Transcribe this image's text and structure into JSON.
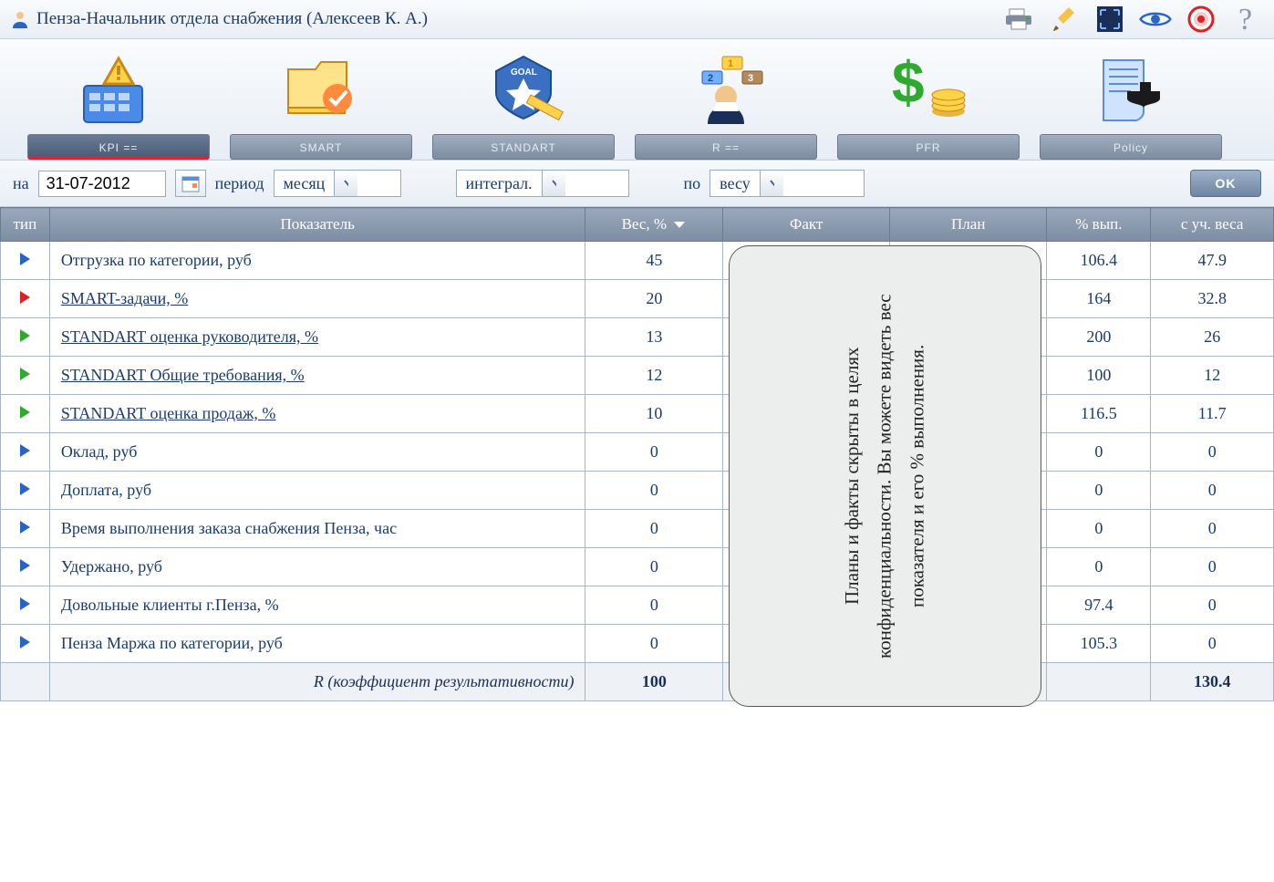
{
  "title": "Пенза-Начальник отдела снабжения  (Алексеев К. А.)",
  "nav": {
    "items": [
      {
        "label": "KPI  =="
      },
      {
        "label": "SMART"
      },
      {
        "label": "STANDART"
      },
      {
        "label": "R  =="
      },
      {
        "label": "PFR"
      },
      {
        "label": "Policy"
      }
    ]
  },
  "filter": {
    "on_label": "на",
    "date": "31-07-2012",
    "period_label": "период",
    "period_value": "месяц",
    "mode_value": "интеграл.",
    "by_label": "по",
    "by_value": "весу",
    "ok": "OK"
  },
  "columns": {
    "type": "тип",
    "indicator": "Показатель",
    "weight": "Вес, %",
    "fact": "Факт",
    "plan": "План",
    "vyp": "% вып.",
    "uweight": "с уч. веса"
  },
  "rows": [
    {
      "tri": "blue",
      "name": "Отгрузка по категории, руб",
      "link": false,
      "weight": "45",
      "vyp": "106.4",
      "uw": "47.9"
    },
    {
      "tri": "red",
      "name": "SMART-задачи, %",
      "link": true,
      "weight": "20",
      "vyp": "164",
      "uw": "32.8"
    },
    {
      "tri": "green",
      "name": "STANDART оценка руководителя, %",
      "link": true,
      "weight": "13",
      "vyp": "200",
      "uw": "26"
    },
    {
      "tri": "green",
      "name": "STANDART Общие требования, %",
      "link": true,
      "weight": "12",
      "vyp": "100",
      "uw": "12"
    },
    {
      "tri": "green",
      "name": "STANDART оценка продаж, %",
      "link": true,
      "weight": "10",
      "vyp": "116.5",
      "uw": "11.7"
    },
    {
      "tri": "blue",
      "name": "Оклад, руб",
      "link": false,
      "weight": "0",
      "vyp": "0",
      "uw": "0"
    },
    {
      "tri": "blue",
      "name": "Доплата, руб",
      "link": false,
      "weight": "0",
      "vyp": "0",
      "uw": "0"
    },
    {
      "tri": "blue",
      "name": "Время выполнения заказа снабжения Пенза, час",
      "link": false,
      "weight": "0",
      "vyp": "0",
      "uw": "0"
    },
    {
      "tri": "blue",
      "name": "Удержано, руб",
      "link": false,
      "weight": "0",
      "vyp": "0",
      "uw": "0"
    },
    {
      "tri": "blue",
      "name": "Довольные клиенты г.Пенза, %",
      "link": false,
      "weight": "0",
      "vyp": "97.4",
      "uw": "0"
    },
    {
      "tri": "blue",
      "name": "Пенза Маржа по категории, руб",
      "link": false,
      "weight": "0",
      "vyp": "105.3",
      "uw": "0"
    }
  ],
  "footer": {
    "label": "R (коэффициент результативности)",
    "weight": "100",
    "uw": "130.4"
  },
  "overlay": {
    "text": "Планы и факты скрыты в целях конфиденциальности. Вы можете видеть вес показателя и его % выполнения."
  }
}
